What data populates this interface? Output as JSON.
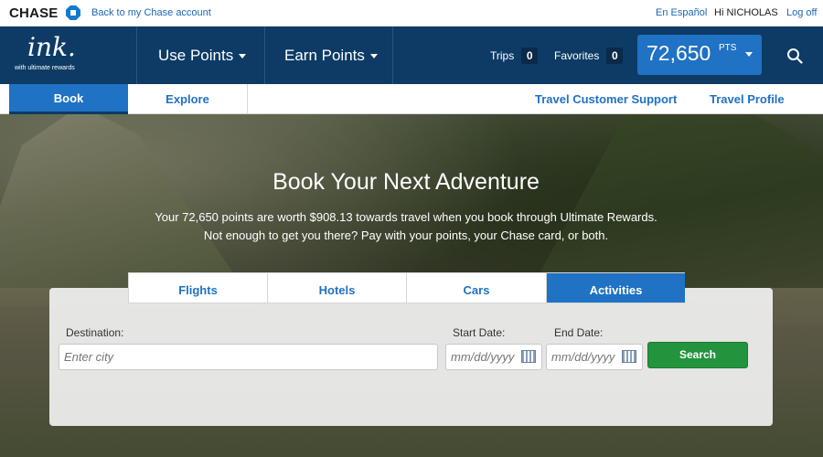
{
  "topbar": {
    "bank_name": "CHASE",
    "back_link": "Back to my Chase account",
    "language_link": "En Español",
    "greeting": "Hi NICHOLAS",
    "logoff_link": "Log off"
  },
  "brand": {
    "logo_text": "ink.",
    "tagline": "with ultimate rewards"
  },
  "mainnav": {
    "use_points": "Use Points",
    "earn_points": "Earn Points",
    "trips_label": "Trips",
    "trips_count": "0",
    "favorites_label": "Favorites",
    "favorites_count": "0",
    "points_value": "72,650",
    "points_unit": "PTS"
  },
  "subnav": {
    "book": "Book",
    "explore": "Explore",
    "support": "Travel Customer Support",
    "profile": "Travel Profile"
  },
  "hero": {
    "title": "Book Your Next Adventure",
    "line1": "Your 72,650 points are worth $908.13 towards travel when you book through Ultimate Rewards.",
    "line2": "Not enough to get you there? Pay with your points, your Chase card, or both."
  },
  "search": {
    "tabs": {
      "flights": "Flights",
      "hotels": "Hotels",
      "cars": "Cars",
      "activities": "Activities"
    },
    "active_tab": "Activities",
    "destination_label": "Destination:",
    "destination_placeholder": "Enter city",
    "start_label": "Start Date:",
    "start_placeholder": "mm/dd/yyyy",
    "end_label": "End Date:",
    "end_placeholder": "mm/dd/yyyy",
    "button": "Search"
  },
  "colors": {
    "nav_bg": "#0d3b66",
    "accent": "#1f72c4",
    "search_button": "#22943d",
    "chase_blue": "#117aca"
  },
  "icons": [
    "chase-octagon-icon",
    "caret-down-icon",
    "search-icon",
    "calendar-icon"
  ]
}
